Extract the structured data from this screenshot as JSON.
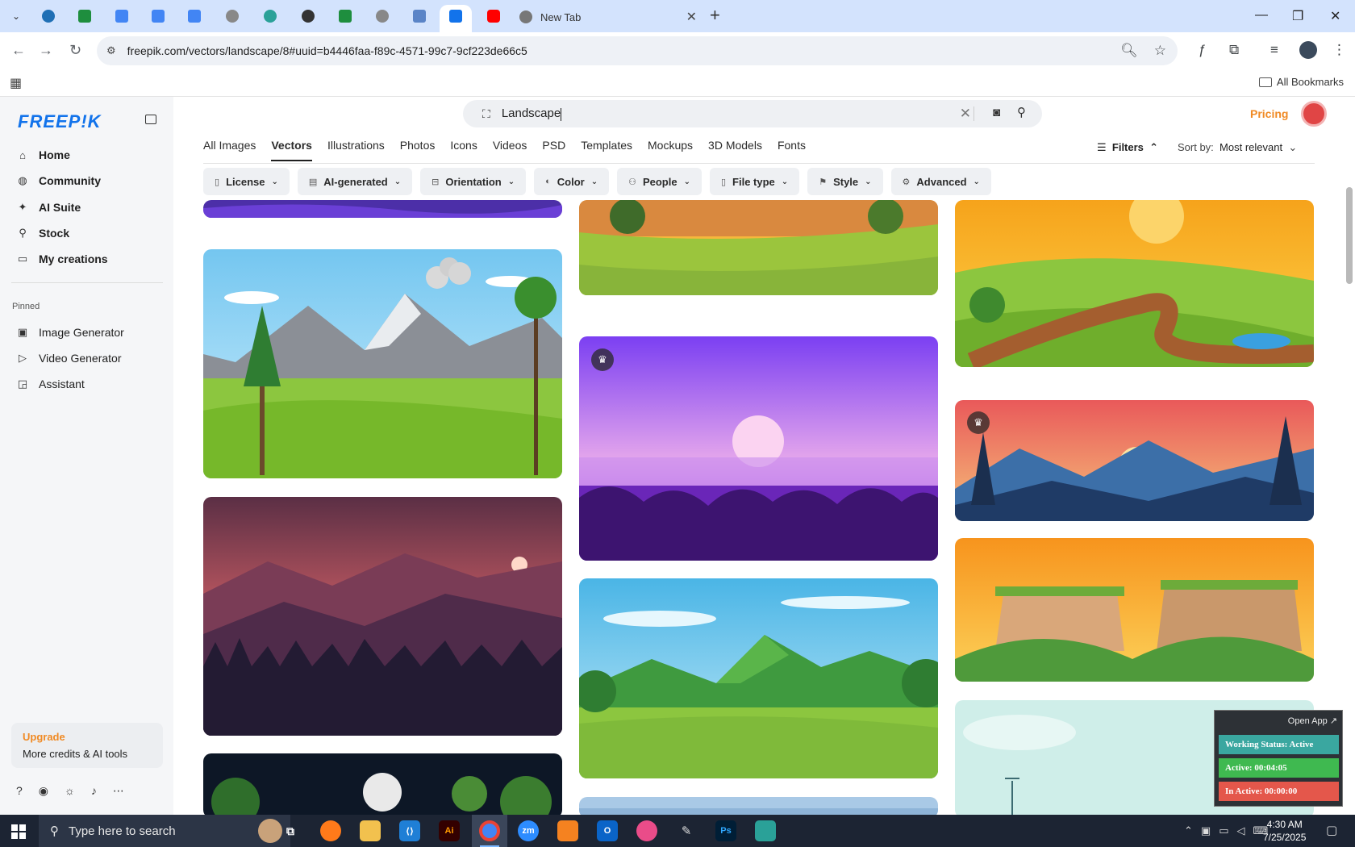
{
  "browser": {
    "new_tab_title": "New Tab",
    "url": "freepik.com/vectors/landscape/8#uuid=b4446faa-f89c-4571-99c7-9cf223de66c5",
    "all_bookmarks": "All Bookmarks"
  },
  "brand": {
    "logo": "FREEP!K"
  },
  "sidebar": {
    "items": [
      {
        "label": "Home",
        "icon": "home-icon"
      },
      {
        "label": "Community",
        "icon": "globe-icon"
      },
      {
        "label": "AI Suite",
        "icon": "sparkle-icon"
      },
      {
        "label": "Stock",
        "icon": "search-icon"
      },
      {
        "label": "My creations",
        "icon": "folder-icon"
      }
    ],
    "pinned_label": "Pinned",
    "pinned": [
      {
        "label": "Image Generator",
        "icon": "image-icon"
      },
      {
        "label": "Video Generator",
        "icon": "video-icon"
      },
      {
        "label": "Assistant",
        "icon": "assistant-icon"
      }
    ],
    "upgrade_title": "Upgrade",
    "upgrade_sub": "More credits & AI tools"
  },
  "search": {
    "value": "Landscape"
  },
  "header": {
    "pricing": "Pricing"
  },
  "categories": [
    "All Images",
    "Vectors",
    "Illustrations",
    "Photos",
    "Icons",
    "Videos",
    "PSD",
    "Templates",
    "Mockups",
    "3D Models",
    "Fonts"
  ],
  "active_category": "Vectors",
  "toolbar": {
    "filters": "Filters",
    "sort_label": "Sort by:",
    "sort_value": "Most relevant"
  },
  "chips": [
    "License",
    "AI-generated",
    "Orientation",
    "Color",
    "People",
    "File type",
    "Style",
    "Advanced"
  ],
  "widget": {
    "open_app": "Open App ↗",
    "status": "Working Status: Active",
    "active": "Active: 00:04:05",
    "inactive": "In Active: 00:00:00"
  },
  "taskbar": {
    "search_placeholder": "Type here to search",
    "time": "4:30 AM",
    "date": "7/25/2025"
  },
  "colors": {
    "accent": "#1273eb",
    "pricing": "#f08a24",
    "active_green": "#3fb950",
    "inactive_red": "#e4574b",
    "status_teal": "#3aa7a0"
  }
}
